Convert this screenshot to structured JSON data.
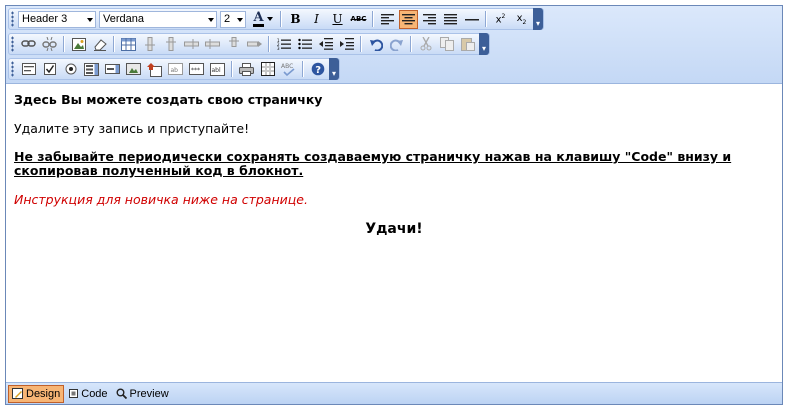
{
  "toolbar": {
    "paragraph_format": "Header 3",
    "font_name": "Verdana",
    "font_size": "2",
    "text_color_label": "A"
  },
  "content": {
    "heading": "Здесь Вы можете создать свою страничку",
    "line2": "Удалите эту запись и приступайте!",
    "notice": "Не забывайте периодически сохранять создаваемую страничку нажав на клавишу \"Code\" внизу и скопировав полученный код в блокнот.",
    "instruction": "Инструкция для новичка ниже на странице.",
    "luck": "Удачи!"
  },
  "modes": {
    "design": "Design",
    "code": "Code",
    "preview": "Preview",
    "active": "Design"
  },
  "colors": {
    "instruction_text": "#d00000",
    "active_button": "#f7b575",
    "toolbar_bg": "#c4d8f5"
  }
}
